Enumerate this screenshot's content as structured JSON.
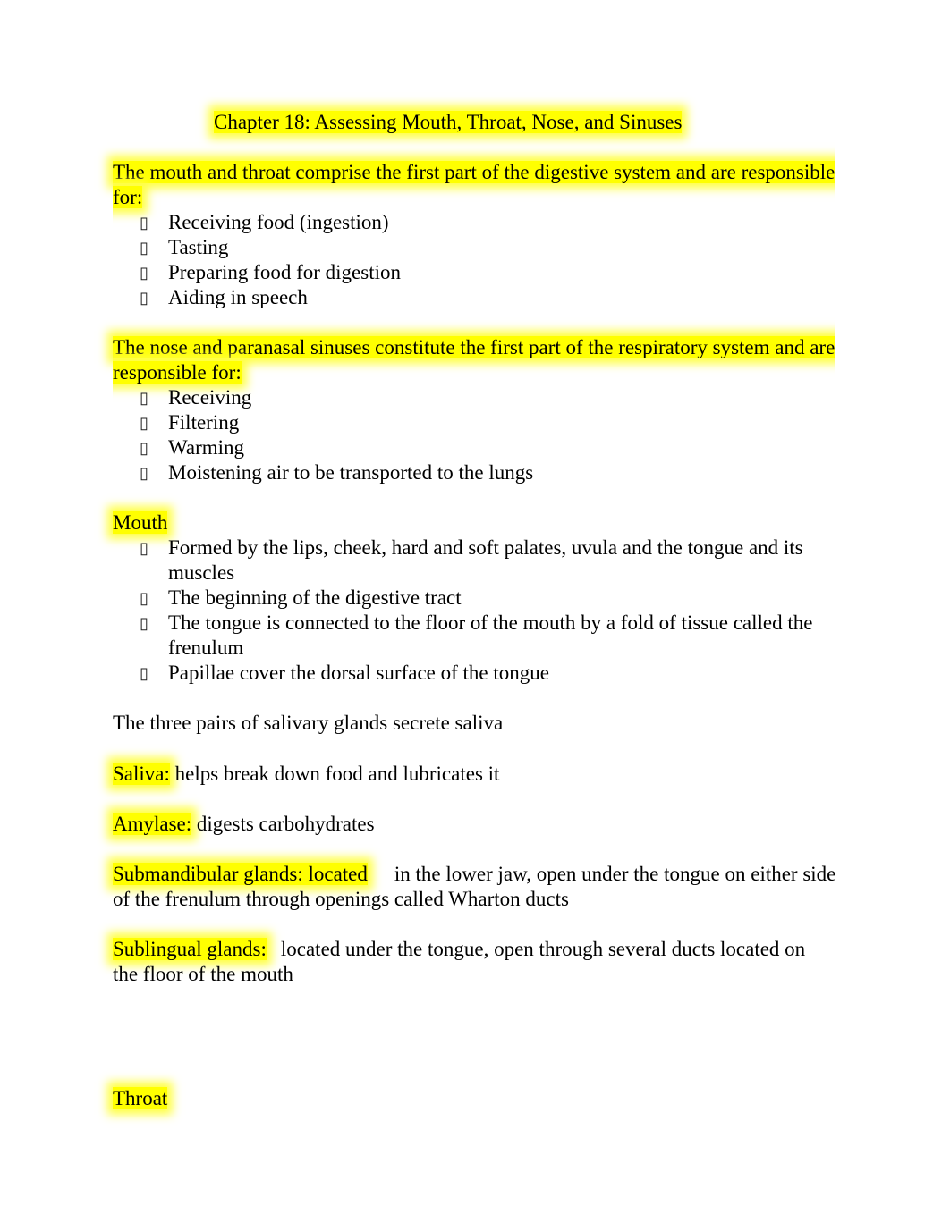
{
  "document": {
    "title": "Chapter 18: Assessing Mouth, Throat, Nose, and Sinuses",
    "sections": [
      {
        "heading": "The mouth and throat comprise the first part of the digestive system and are responsible for:",
        "items": [
          "Receiving food (ingestion)",
          "Tasting",
          "Preparing food for digestion",
          "Aiding in speech"
        ]
      },
      {
        "heading": "The nose and paranasal sinuses constitute the first part of the respiratory system and are responsible for:",
        "items": [
          "Receiving",
          "Filtering",
          "Warming",
          "Moistening air to be transported to the lungs"
        ]
      },
      {
        "heading": "Mouth",
        "items": [
          "Formed by the lips, cheek, hard and soft palates, uvula and the tongue and its muscles",
          "The beginning of the digestive tract",
          "The tongue is connected to the floor of the mouth by a fold of tissue called the frenulum",
          "Papillae cover the dorsal surface of the tongue"
        ]
      }
    ],
    "salivary_intro": "The three pairs of salivary glands secrete saliva",
    "definitions": [
      {
        "term": "Saliva:",
        "text": "helps break down food and lubricates it"
      },
      {
        "term": "Amylase:",
        "text": "digests carbohydrates"
      },
      {
        "term": "Submandibular glands: located",
        "text": "in the lower jaw, open under the tongue on either side of the frenulum through openings called Wharton ducts"
      },
      {
        "term": "Sublingual glands:",
        "text": "located under the tongue, open through several ducts located on the floor of the mouth"
      }
    ],
    "throat_heading": "Throat",
    "bullet_glyph": "▯",
    "highlight_color": "#ffff00"
  }
}
